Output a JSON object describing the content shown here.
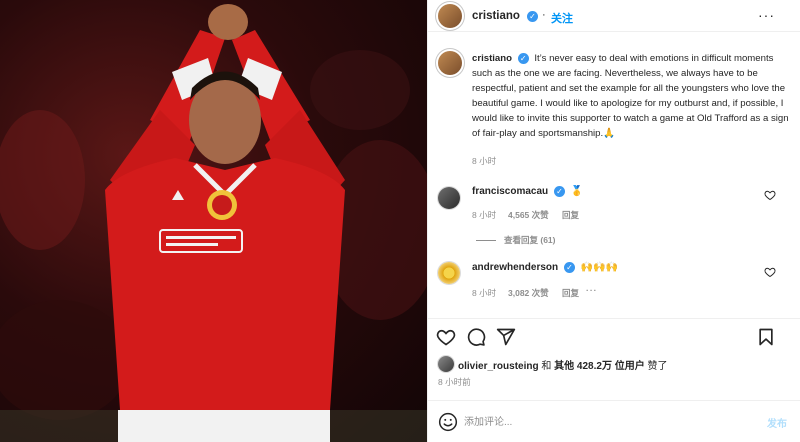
{
  "post": {
    "username": "cristiano",
    "follow_label": "关注",
    "more_label": "···",
    "caption": "It’s never easy to deal with emotions in difficult moments such as the one we are facing. Nevertheless, we always have to be respectful, patient and set the example for all the youngsters who love the beautiful game. I would like to apologize for my outburst and, if possible, I would like to invite this supporter to watch a game at Old Trafford as a sign of fair-play and sportsmanship.🙏",
    "caption_time": "8 小时"
  },
  "comments": [
    {
      "username": "franciscomacau",
      "text": "🥇",
      "time": "8 小时",
      "likes": "4,565 次赞",
      "reply": "回复",
      "view_replies": "查看回复 (61)"
    },
    {
      "username": "andrewhenderson",
      "text": "🙌🙌🙌",
      "time": "8 小时",
      "likes": "3,082 次赞",
      "reply": "回复"
    }
  ],
  "likes": {
    "user": "olivier_rousteing",
    "connector": "和",
    "others": "其他 428.2万 位用户",
    "suffix": "赞了"
  },
  "post_time": "8 小时前",
  "comment_box": {
    "placeholder": "添加评论...",
    "post_label": "发布"
  },
  "colors": {
    "accent": "#0095f6",
    "verified": "#3897f0",
    "jersey": "#d31b1b"
  },
  "icons": [
    "heart-icon",
    "comment-icon",
    "share-icon",
    "bookmark-icon",
    "emoji-icon",
    "verified-icon"
  ]
}
